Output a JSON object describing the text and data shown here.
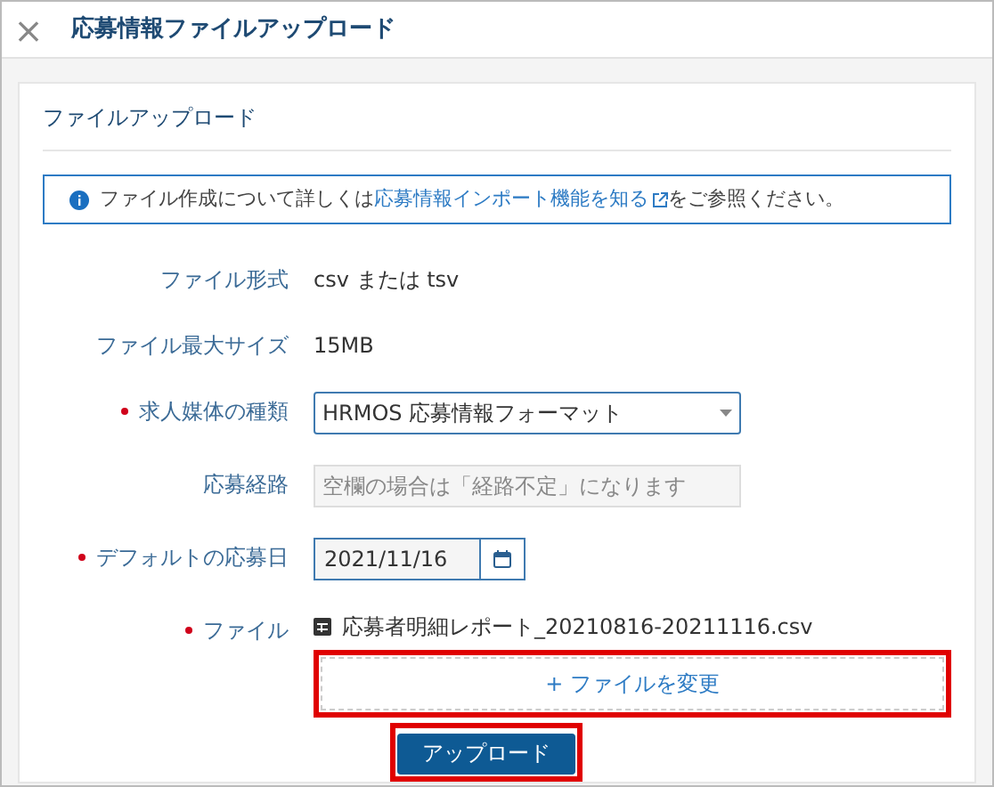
{
  "dialog": {
    "close_icon": "×",
    "title": "応募情報ファイルアップロード"
  },
  "section": {
    "title": "ファイルアップロード",
    "info": {
      "before": "ファイル作成について詳しくは",
      "link": "応募情報インポート機能を知る",
      "after": "をご参照ください。"
    },
    "fields": [
      {
        "kind": "text",
        "label": "ファイル形式",
        "required": false,
        "value": "csv または tsv"
      },
      {
        "kind": "text",
        "label": "ファイル最大サイズ",
        "required": false,
        "value": "15MB"
      },
      {
        "kind": "select",
        "label": "求人媒体の種類",
        "required": true,
        "value": "HRMOS 応募情報フォーマット"
      },
      {
        "kind": "input",
        "label": "応募経路",
        "required": false,
        "placeholder": "空欄の場合は「経路不定」になります"
      },
      {
        "kind": "date",
        "label": "デフォルトの応募日",
        "required": true,
        "value": "2021/11/16"
      },
      {
        "kind": "file",
        "label": "ファイル",
        "required": true,
        "file_name": "応募者明細レポート_20210816-20211116.csv",
        "button": "+ ファイルを変更",
        "highlighted": true
      }
    ],
    "submit": {
      "label": "アップロード",
      "highlighted": true
    }
  }
}
